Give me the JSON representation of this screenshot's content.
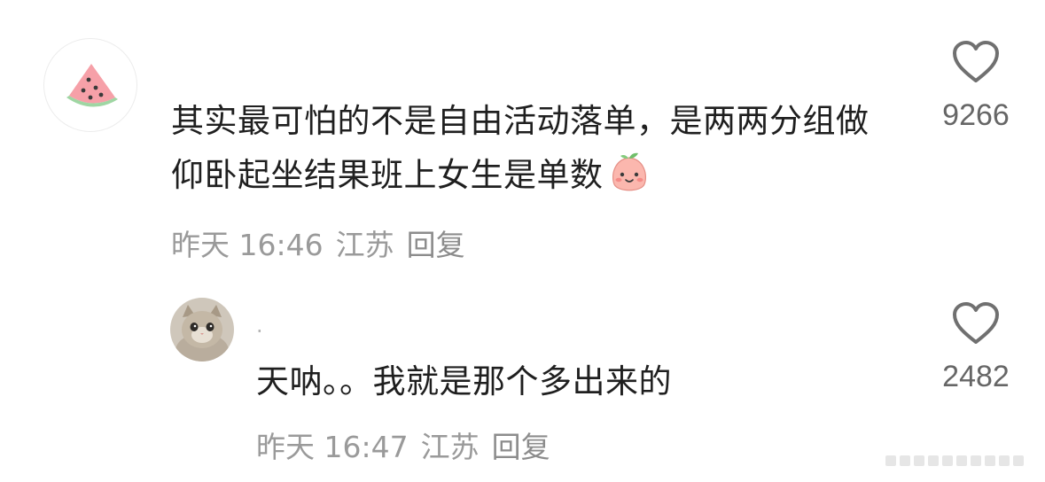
{
  "comments": [
    {
      "avatar_icon": "watermelon-icon",
      "text": "其实最可怕的不是自由活动落单，是两两分组做仰卧起坐结果班上女生是单数",
      "emoji_icon": "peach-smile-emoji-icon",
      "time": "昨天 16:46",
      "location": "江苏",
      "reply_label": "回复",
      "likes": "9266"
    },
    {
      "avatar_icon": "kitten-photo-avatar",
      "username": "·",
      "text": "天呐。。我就是那个多出来的",
      "time": "昨天 16:47",
      "location": "江苏",
      "reply_label": "回复",
      "likes": "2482"
    }
  ],
  "colors": {
    "text": "#1f1f1f",
    "meta": "#9a9a9a",
    "count": "#666666",
    "heart_stroke": "#707070"
  }
}
